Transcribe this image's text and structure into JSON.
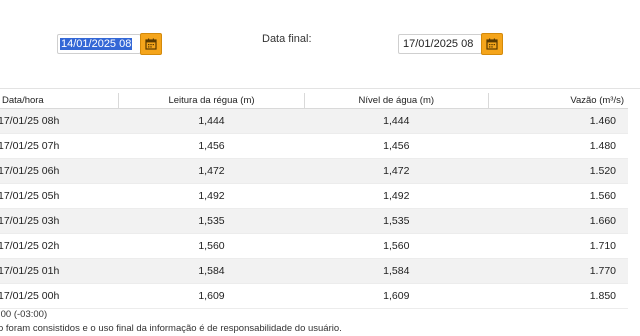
{
  "filters": {
    "start_value_selected": "14/01/2025 08",
    "start_icon": "calendar-icon",
    "end_label": "Data final:",
    "end_value": "17/01/2025 08",
    "end_icon": "calendar-icon",
    "accent_color": "#f5a51b",
    "selection_color": "#3367d6"
  },
  "table": {
    "headers": [
      "Data/hora",
      "Leitura da régua (m)",
      "Nível de água (m)",
      "Vazão (m³/s)"
    ],
    "rows": [
      [
        "17/01/25 08h",
        "1,444",
        "1,444",
        "1.460"
      ],
      [
        "17/01/25 07h",
        "1,456",
        "1,456",
        "1.480"
      ],
      [
        "17/01/25 06h",
        "1,472",
        "1,472",
        "1.520"
      ],
      [
        "17/01/25 05h",
        "1,492",
        "1,492",
        "1.560"
      ],
      [
        "17/01/25 03h",
        "1,535",
        "1,535",
        "1.660"
      ],
      [
        "17/01/25 02h",
        "1,560",
        "1,560",
        "1.710"
      ],
      [
        "17/01/25 01h",
        "1,584",
        "1,584",
        "1.770"
      ],
      [
        "17/01/25 00h",
        "1,609",
        "1,609",
        "1.850"
      ]
    ]
  },
  "footer": {
    "timezone": ":00 (-03:00)",
    "disclaimer": "o foram consistidos e o uso final da informação é de responsabilidade do usuário."
  }
}
